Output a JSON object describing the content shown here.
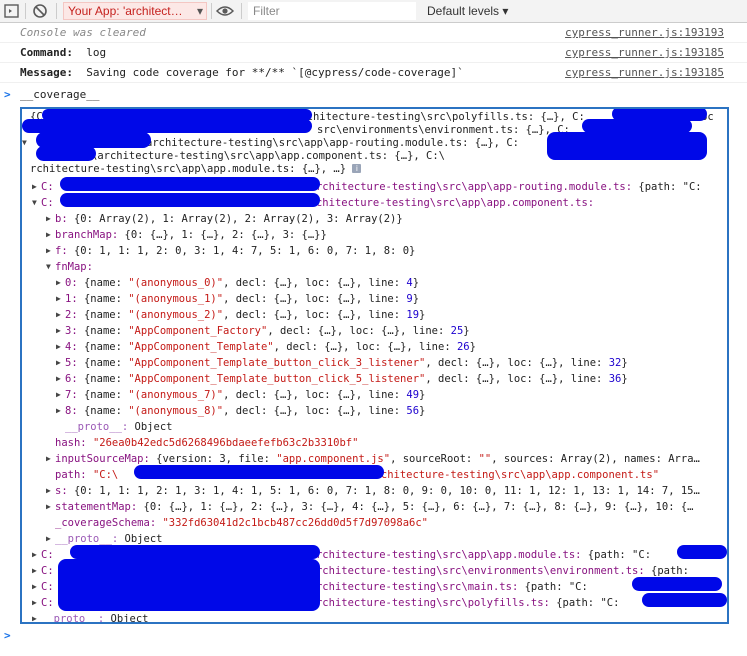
{
  "toolbar": {
    "context": "Your App: 'architect…",
    "filter_placeholder": "Filter",
    "levels": "Default levels ▾"
  },
  "console": {
    "messages": [
      {
        "text": "Console was cleared",
        "source": "cypress_runner.js:193193"
      },
      {
        "label": "Command:",
        "text": "log",
        "source": "cypress_runner.js:193185"
      },
      {
        "label": "Message:",
        "text": "Saving code coverage for **/** `[@cypress/code-coverage]`",
        "source": "cypress_runner.js:193185"
      }
    ],
    "input_echo": "__coverage__",
    "prompt_symbol": ">",
    "prompt_symbol_output": "<"
  },
  "object_tree": {
    "summary_lines": [
      "{C:\\",
      "rchitecture-testing\\src\\polyfills.ts: {…}, C:",
      "Doc",
      "src\\environments\\environment.ts: {…}, C:",
      "architecture-testing\\src\\app\\app-routing.module.ts: {…}, C:",
      "\\architecture-testing\\src\\app\\app.component.ts: {…}, C:\\",
      "rchitecture-testing\\src\\app\\app.module.ts: {…}, …}"
    ],
    "entries": {
      "routing": {
        "pre": "C:",
        "path": "architecture-testing\\src\\app\\app-routing.module.ts:",
        "rest": " {path: \"C:"
      },
      "component": {
        "pre": "C:",
        "path": "rchitecture-testing\\src\\app\\app.component.ts:"
      },
      "b": {
        "key": "b:",
        "value": " {0: Array(2), 1: Array(2), 2: Array(2), 3: Array(2)}"
      },
      "branchMap": {
        "key": "branchMap:",
        "value": " {0: {…}, 1: {…}, 2: {…}, 3: {…}}"
      },
      "f": {
        "key": "f:",
        "value": " {0: 1, 1: 1, 2: 0, 3: 1, 4: 7, 5: 1, 6: 0, 7: 1, 8: 0}"
      },
      "fnMap": {
        "key": "fnMap:"
      },
      "fn": [
        {
          "idx": "0:",
          "name": "\"(anonymous_0)\"",
          "line": "4"
        },
        {
          "idx": "1:",
          "name": "\"(anonymous_1)\"",
          "line": "9"
        },
        {
          "idx": "2:",
          "name": "\"(anonymous_2)\"",
          "line": "19"
        },
        {
          "idx": "3:",
          "name": "\"AppComponent_Factory\"",
          "line": "25"
        },
        {
          "idx": "4:",
          "name": "\"AppComponent_Template\"",
          "line": "26"
        },
        {
          "idx": "5:",
          "name": "\"AppComponent_Template_button_click_3_listener\"",
          "line": "32"
        },
        {
          "idx": "6:",
          "name": "\"AppComponent_Template_button_click_5_listener\"",
          "line": "36"
        },
        {
          "idx": "7:",
          "name": "\"(anonymous_7)\"",
          "line": "49"
        },
        {
          "idx": "8:",
          "name": "\"(anonymous_8)\"",
          "line": "56"
        }
      ],
      "fn_name_label": " {name: ",
      "fn_mid": ", decl: {…}, loc: {…}, line: ",
      "fn_end": "}",
      "proto_inner": {
        "key": "__proto__:",
        "value": " Object"
      },
      "hash": {
        "key": "hash:",
        "value": "\"26ea0b42edc5d6268496bdaeefefb63c2b3310bf\""
      },
      "inputSourceMap": {
        "key": "inputSourceMap:",
        "value": " {version: 3, file: ",
        "file": "\"app.component.js\"",
        "mid": ", sourceRoot: ",
        "root": "\"\"",
        "end": ", sources: Array(2), names: Arra…"
      },
      "path": {
        "key": "path:",
        "value_start": "\"C:\\",
        "value_end": "architecture-testing\\src\\app\\app.component.ts\""
      },
      "s": {
        "key": "s:",
        "value": " {0: 1, 1: 1, 2: 1, 3: 1, 4: 1, 5: 1, 6: 0, 7: 1, 8: 0, 9: 0, 10: 0, 11: 1, 12: 1, 13: 1, 14: 7, 15…"
      },
      "statementMap": {
        "key": "statementMap:",
        "value": " {0: {…}, 1: {…}, 2: {…}, 3: {…}, 4: {…}, 5: {…}, 6: {…}, 7: {…}, 8: {…}, 9: {…}, 10: {…"
      },
      "coverageSchema": {
        "key": "_coverageSchema:",
        "value": "\"332fd63041d2c1bcb487cc26dd0d5f7d97098a6c\""
      },
      "proto_component": {
        "key": "__proto__:",
        "value": " Object"
      },
      "module": {
        "pre": "C:",
        "path": "architecture-testing\\src\\app\\app.module.ts:",
        "rest": " {path: \"C:"
      },
      "environment": {
        "pre": "C:",
        "path": "architecture-testing\\src\\environments\\environment.ts:",
        "rest": " {path:"
      },
      "main": {
        "pre": "C:",
        "path": "architecture-testing\\src\\main.ts:",
        "rest": " {path: \"C:"
      },
      "polyfills": {
        "pre": "C:",
        "path": "architecture-testing\\src\\polyfills.ts:",
        "rest": " {path: \"C:"
      },
      "proto_root": {
        "key": "__proto__:",
        "value": " Object"
      }
    }
  },
  "colors": {
    "key": "#881280",
    "string": "#c41a16",
    "number": "#1c00cf",
    "selection_border": "#2b73c2",
    "redaction": "#0008e8",
    "prompt": "#1a73e8"
  },
  "icons": [
    "sidebar-toggle-icon",
    "clear-console-icon",
    "eye-icon",
    "info-icon"
  ]
}
